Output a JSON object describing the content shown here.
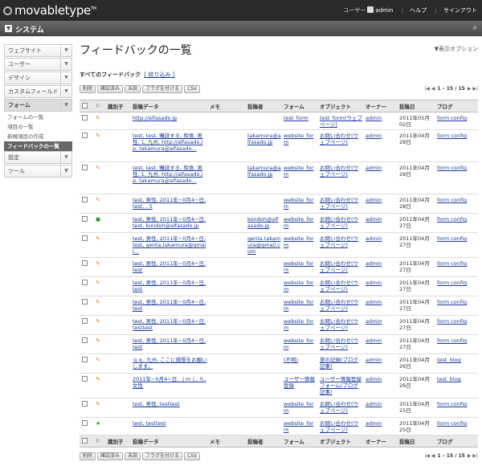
{
  "app": {
    "logo": "movabletype",
    "tm": "TM"
  },
  "topnav": {
    "user_label": "ユーザー",
    "user_name": "admin",
    "help": "ヘルプ",
    "signout": "サインアウト"
  },
  "system_bar": {
    "title": "システム"
  },
  "sidebar": {
    "items": [
      {
        "label": "ウェブサイト"
      },
      {
        "label": "ユーザー"
      },
      {
        "label": "デザイン"
      },
      {
        "label": "カスタムフィールド"
      }
    ],
    "form": {
      "label": "フォーム",
      "subitems": [
        "フォームの一覧",
        "項目の一覧",
        "新規項目の作成",
        "フィードバックの一覧"
      ]
    },
    "after": [
      {
        "label": "設定"
      },
      {
        "label": "ツール"
      }
    ]
  },
  "main": {
    "title": "フィードバックの一覧",
    "display_options": "▼表示オプション",
    "filter_label": "すべてのフィードバック",
    "filter_link": "[ 絞り込み ]",
    "actions": [
      "削除",
      "確認済み",
      "未読",
      "フラグを付ける",
      "CSV"
    ],
    "pager": {
      "range": "1 – 15 / 15"
    }
  },
  "table": {
    "headers": [
      "識別子",
      "投稿データ",
      "メモ",
      "投稿者",
      "フォーム",
      "オブジェクト",
      "オーナー",
      "投稿日",
      "ブログ"
    ],
    "rows": [
      {
        "icon": "pencil",
        "data": "http://alfasado.jp",
        "author": "",
        "form": "test_form",
        "object": "test_form(ウェブページ)",
        "owner": "admin",
        "date": "2011年05月02日",
        "blog": "form config"
      },
      {
        "icon": "pencil",
        "data": "test, test, 購読する, 和食, 男性, 1, 九州, http://alfasado.jp, takamura@alfasado...",
        "author": "takamura@alfasado.jp",
        "form": "website_form",
        "object": "お問い合わせ(ウェブページ)",
        "owner": "admin",
        "date": "2011年04月28日",
        "blog": "form config"
      },
      {
        "icon": "pencil",
        "data": "test, test, 購読する, 和食, 男性, 1, 九州, http://alfasado.jp, takamura@alfasado...",
        "author": "takamura@alfasado.jp",
        "form": "website_form",
        "object": "お問い合わせ(ウェブページ)",
        "owner": "admin",
        "date": "2011年04月28日",
        "blog": "form config"
      },
      {
        "icon": "pencil",
        "data": "test, 男性, 2011年−0月4−日, test, , 5",
        "author": "",
        "form": "website_form",
        "object": "お問い合わせ(ウェブページ)",
        "owner": "admin",
        "date": "2011年04月28日",
        "blog": "form config"
      },
      {
        "icon": "check",
        "data": "test, 男性, 2011年−0月4−日, test, kondoh@alfasado.jp",
        "author": "kondoh@alfasado.jp",
        "form": "website_form",
        "object": "お問い合わせ(ウェブページ)",
        "owner": "admin",
        "date": "2011年04月27日",
        "blog": "form config"
      },
      {
        "icon": "pencil",
        "data": "test, 男性, 2011年−0月4−日, test, genta.takamura@gmail...",
        "author": "genta.takamura@gmail.com",
        "form": "website_form",
        "object": "お問い合わせ(ウェブページ)",
        "owner": "admin",
        "date": "2011年04月27日",
        "blog": "form config"
      },
      {
        "icon": "pencil",
        "data": "test, 男性, 2011年−0月4−日, test",
        "author": "",
        "form": "website_form",
        "object": "お問い合わせ(ウェブページ)",
        "owner": "admin",
        "date": "2011年04月27日",
        "blog": "form config"
      },
      {
        "icon": "pencil",
        "data": "test, 男性, 2011年−0月4−日, test",
        "author": "",
        "form": "website_form",
        "object": "お問い合わせ(ウェブページ)",
        "owner": "admin",
        "date": "2011年04月27日",
        "blog": "form config"
      },
      {
        "icon": "pencil",
        "data": "test, 男性, 2011年−0月4−日, test",
        "author": "",
        "form": "website_form",
        "object": "お問い合わせ(ウェブページ)",
        "owner": "admin",
        "date": "2011年04月27日",
        "blog": "form config"
      },
      {
        "icon": "pencil",
        "data": "test, 男性, 2011年−0月4−日, testtest",
        "author": "",
        "form": "website_form",
        "object": "お問い合わせ(ウェブページ)",
        "owner": "admin",
        "date": "2011年04月27日",
        "blog": "form config"
      },
      {
        "icon": "pencil",
        "data": "test, 男性, 2011年−0月4−日, test",
        "author": "",
        "form": "website_form",
        "object": "お問い合わせ(ウェブページ)",
        "owner": "admin",
        "date": "2011年04月27日",
        "blog": "form config"
      },
      {
        "icon": "pencil",
        "data": "ｑｑ, 九州, ここに感想をお願いします。",
        "author": "",
        "form": "(不明)",
        "object": "旅の記録(ブログ記事)",
        "owner": "admin",
        "date": "2011年04月26日",
        "blog": "test_blog"
      },
      {
        "icon": "pencil",
        "data": "2011年−0月4−日, ｊｍｊ, ｈ, 女性",
        "author": "",
        "form": "ユーザー情報登録",
        "object": "ユーザー情報登録フォーム(ブログ記事)",
        "owner": "admin",
        "date": "2011年04月26日",
        "blog": "test_blog"
      },
      {
        "icon": "pencil",
        "data": "test, 男性, testtest",
        "author": "",
        "form": "website_form",
        "object": "お問い合わせ(ウェブページ)",
        "owner": "admin",
        "date": "2011年04月25日",
        "blog": "form config"
      },
      {
        "icon": "star",
        "data": "test, testtest",
        "author": "",
        "form": "website_form",
        "object": "お問い合わせ(ウェブページ)",
        "owner": "admin",
        "date": "2011年04月25日",
        "blog": "form config"
      }
    ]
  }
}
